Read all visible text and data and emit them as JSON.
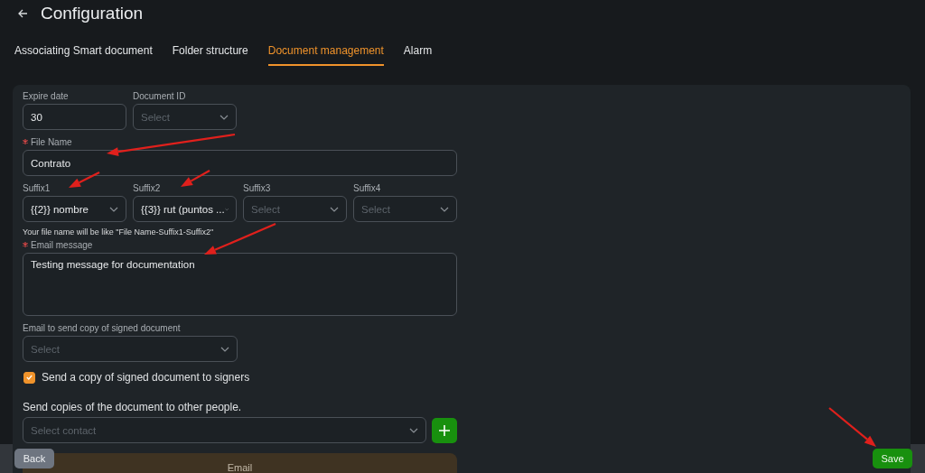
{
  "header": {
    "title": "Configuration"
  },
  "tabs": [
    {
      "label": "Associating Smart document",
      "selected": false
    },
    {
      "label": "Folder structure",
      "selected": false
    },
    {
      "label": "Document management",
      "selected": true
    },
    {
      "label": "Alarm",
      "selected": false
    }
  ],
  "form": {
    "rows": [
      [
        {
          "kind": "input",
          "label": "Expire date",
          "required": false,
          "value": "30"
        },
        {
          "kind": "select",
          "label": "Document ID",
          "required": false,
          "placeholder": "Select"
        }
      ],
      [
        {
          "kind": "input",
          "label": "File Name",
          "required": true,
          "value": "Contrato"
        }
      ],
      [
        {
          "kind": "select",
          "label": "Suffix1",
          "required": false,
          "value": "{{2}} nombre"
        },
        {
          "kind": "select",
          "label": "Suffix2",
          "required": false,
          "value": "{{3}} rut (puntos ..."
        },
        {
          "kind": "select",
          "label": "Suffix3",
          "required": false,
          "placeholder": "Select"
        },
        {
          "kind": "select",
          "label": "Suffix4",
          "required": false,
          "placeholder": "Select"
        }
      ]
    ],
    "hint": "Your file name will be like \"File Name-Suffix1-Suffix2\"",
    "rows2": [
      [
        {
          "kind": "textarea",
          "label": "Email message",
          "required": true,
          "value": "Testing message for documentation"
        }
      ],
      [
        {
          "kind": "select",
          "label": "Email to send copy of signed document",
          "required": false,
          "placeholder": "Select"
        }
      ]
    ],
    "checkbox": {
      "label": "Send a copy of signed document to signers",
      "checked": true
    },
    "copies_heading": "Send copies of the document to other people.",
    "contact_select": {
      "placeholder": "Select contact"
    },
    "email_section": {
      "label": "Email"
    }
  },
  "footer": {
    "back": "Back",
    "save": "Save"
  }
}
